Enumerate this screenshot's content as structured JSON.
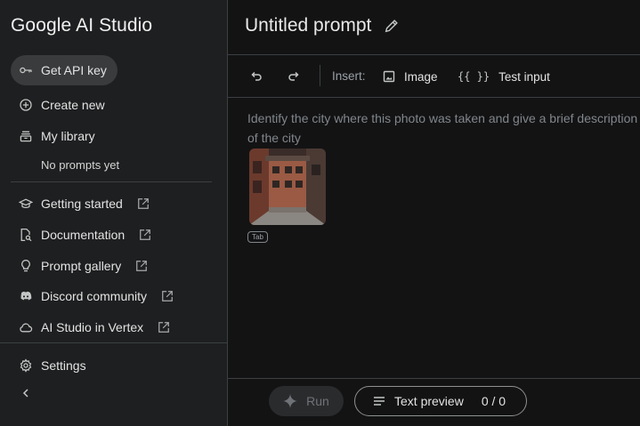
{
  "sidebar": {
    "brand": "Google AI Studio",
    "api_key": {
      "label": "Get API key",
      "icon": "key-icon"
    },
    "create_new": {
      "label": "Create new",
      "icon": "plus-circle-icon"
    },
    "my_library": {
      "label": "My library",
      "icon": "library-icon"
    },
    "no_prompts": "No prompts yet",
    "links": [
      {
        "label": "Getting started",
        "icon": "graduation-cap-icon"
      },
      {
        "label": "Documentation",
        "icon": "document-search-icon"
      },
      {
        "label": "Prompt gallery",
        "icon": "lightbulb-icon"
      },
      {
        "label": "Discord community",
        "icon": "discord-icon"
      },
      {
        "label": "AI Studio in Vertex",
        "icon": "cloud-icon"
      }
    ],
    "settings": {
      "label": "Settings",
      "icon": "gear-icon"
    }
  },
  "header": {
    "title": "Untitled prompt"
  },
  "toolbar": {
    "insert_label": "Insert:",
    "image_label": "Image",
    "test_input_glyph": "{{ }}",
    "test_input_label": "Test input"
  },
  "prompt": {
    "line1": "Identify the city where this photo was taken and give a brief description",
    "line2": "of the city",
    "tab_badge": "Tab"
  },
  "footer": {
    "run_label": "Run",
    "text_preview_label": "Text preview",
    "token_count": "0 / 0"
  },
  "colors": {
    "sidebar_bg": "#1e1f20",
    "main_bg": "#131314",
    "active_pill": "#393b3d"
  }
}
